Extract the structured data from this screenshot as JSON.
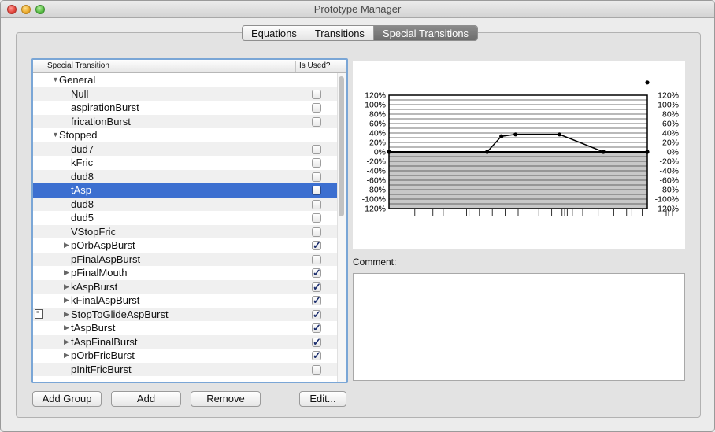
{
  "window": {
    "title": "Prototype Manager"
  },
  "tabs": [
    {
      "label": "Equations",
      "active": false
    },
    {
      "label": "Transitions",
      "active": false
    },
    {
      "label": "Special Transitions",
      "active": true
    }
  ],
  "table": {
    "col1": "Special Transition",
    "col2": "Is Used?",
    "rows": [
      {
        "label": "General",
        "kind": "group",
        "expanded": true
      },
      {
        "label": "Null",
        "kind": "item",
        "used": false
      },
      {
        "label": "aspirationBurst",
        "kind": "item",
        "used": false
      },
      {
        "label": "fricationBurst",
        "kind": "item",
        "used": false
      },
      {
        "label": "Stopped",
        "kind": "group",
        "expanded": true
      },
      {
        "label": "dud7",
        "kind": "item",
        "used": false
      },
      {
        "label": "kFric",
        "kind": "item",
        "used": false
      },
      {
        "label": "dud8",
        "kind": "item",
        "used": false
      },
      {
        "label": "tAsp",
        "kind": "item",
        "used": false,
        "selected": true
      },
      {
        "label": "dud8",
        "kind": "item",
        "used": false
      },
      {
        "label": "dud5",
        "kind": "item",
        "used": false
      },
      {
        "label": "VStopFric",
        "kind": "item",
        "used": false
      },
      {
        "label": "pOrbAspBurst",
        "kind": "item",
        "used": true,
        "disclosure": true
      },
      {
        "label": "pFinalAspBurst",
        "kind": "item",
        "used": false
      },
      {
        "label": "pFinalMouth",
        "kind": "item",
        "used": true,
        "disclosure": true
      },
      {
        "label": "kAspBurst",
        "kind": "item",
        "used": true,
        "disclosure": true
      },
      {
        "label": "kFinalAspBurst",
        "kind": "item",
        "used": true,
        "disclosure": true
      },
      {
        "label": "StopToGlideAspBurst",
        "kind": "item",
        "used": true,
        "disclosure": true,
        "note": true
      },
      {
        "label": "tAspBurst",
        "kind": "item",
        "used": true,
        "disclosure": true
      },
      {
        "label": "tAspFinalBurst",
        "kind": "item",
        "used": true,
        "disclosure": true
      },
      {
        "label": "pOrbFricBurst",
        "kind": "item",
        "used": true,
        "disclosure": true
      },
      {
        "label": "pInitFricBurst",
        "kind": "item",
        "used": false
      }
    ]
  },
  "comment": {
    "label": "Comment:",
    "value": ""
  },
  "buttons": {
    "add_group": "Add Group",
    "add": "Add",
    "remove": "Remove",
    "edit": "Edit..."
  },
  "chart_data": {
    "type": "line",
    "y_tick_labels": [
      "120%",
      "100%",
      "80%",
      "60%",
      "40%",
      "20%",
      "0%",
      "-20%",
      "-40%",
      "-60%",
      "-80%",
      "-100%",
      "-120%"
    ],
    "ylim": [
      -120,
      120
    ],
    "grid": true,
    "x_range": [
      0,
      100
    ],
    "points": [
      {
        "x": 0,
        "y": 0
      },
      {
        "x": 38,
        "y": 0
      },
      {
        "x": 43.5,
        "y": 33
      },
      {
        "x": 49,
        "y": 37
      },
      {
        "x": 66,
        "y": 37
      },
      {
        "x": 83,
        "y": 0
      },
      {
        "x": 100,
        "y": 0
      }
    ],
    "extra_point": {
      "x": 100,
      "y": 147
    },
    "tick_marks": [
      10,
      17,
      21,
      30,
      31,
      35,
      40,
      45,
      50,
      58,
      63,
      67,
      68,
      69,
      71,
      75,
      81,
      87,
      92,
      94,
      98
    ]
  }
}
